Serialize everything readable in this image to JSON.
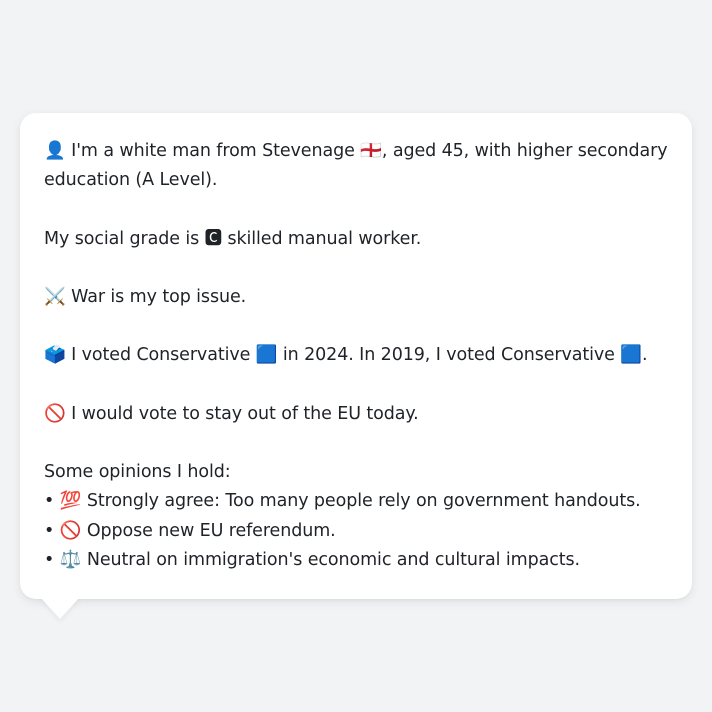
{
  "intro": {
    "line1": "👤 I'm a white man from Stevenage 🏴󠁧󠁢󠁥󠁮󠁧󠁿, aged 45, with higher secondary",
    "line2": "education (A Level)."
  },
  "social_grade": "My social grade is 🅲 skilled manual worker.",
  "top_issue": "⚔️ War is my top issue.",
  "vote_history": "🗳️ I voted Conservative 🟦 in 2024. In 2019, I voted Conservative 🟦.",
  "eu_stance": "🚫 I would vote to stay out of the EU today.",
  "opinions": {
    "heading": "Some opinions I hold:",
    "items": [
      "• 💯 Strongly agree: Too many people rely on government handouts.",
      "• 🚫 Oppose new EU referendum.",
      "• ⚖️ Neutral on immigration's economic and cultural impacts."
    ]
  }
}
